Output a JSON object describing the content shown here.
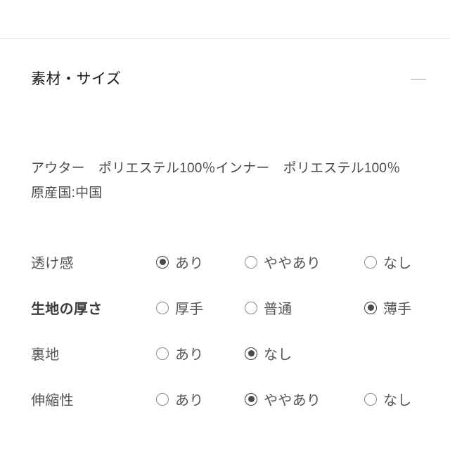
{
  "section": {
    "title": "素材・サイズ",
    "collapse_icon": "minus-icon"
  },
  "composition": {
    "line1": "アウター　ポリエステル100％インナー　ポリエステル100％",
    "line2": "原産国:中国"
  },
  "attributes": [
    {
      "label": "透け感",
      "bold": false,
      "options": [
        {
          "label": "あり",
          "selected": true
        },
        {
          "label": "ややあり",
          "selected": false
        },
        {
          "label": "なし",
          "selected": false
        }
      ]
    },
    {
      "label": "生地の厚さ",
      "bold": true,
      "options": [
        {
          "label": "厚手",
          "selected": false
        },
        {
          "label": "普通",
          "selected": false
        },
        {
          "label": "薄手",
          "selected": true
        }
      ]
    },
    {
      "label": "裏地",
      "bold": false,
      "options": [
        {
          "label": "あり",
          "selected": false
        },
        {
          "label": "なし",
          "selected": true
        }
      ]
    },
    {
      "label": "伸縮性",
      "bold": false,
      "options": [
        {
          "label": "あり",
          "selected": false
        },
        {
          "label": "ややあり",
          "selected": true
        },
        {
          "label": "なし",
          "selected": false
        }
      ]
    }
  ],
  "colors": {
    "background": "#ffffff",
    "title_text": "#1a1a1a",
    "body_text": "#555555",
    "muted_text": "#4a4a4a",
    "divider": "#e4e4e4",
    "radio_border": "#888888",
    "radio_dot": "#4a4a4a",
    "toggle_bar": "#cfcfcf"
  }
}
